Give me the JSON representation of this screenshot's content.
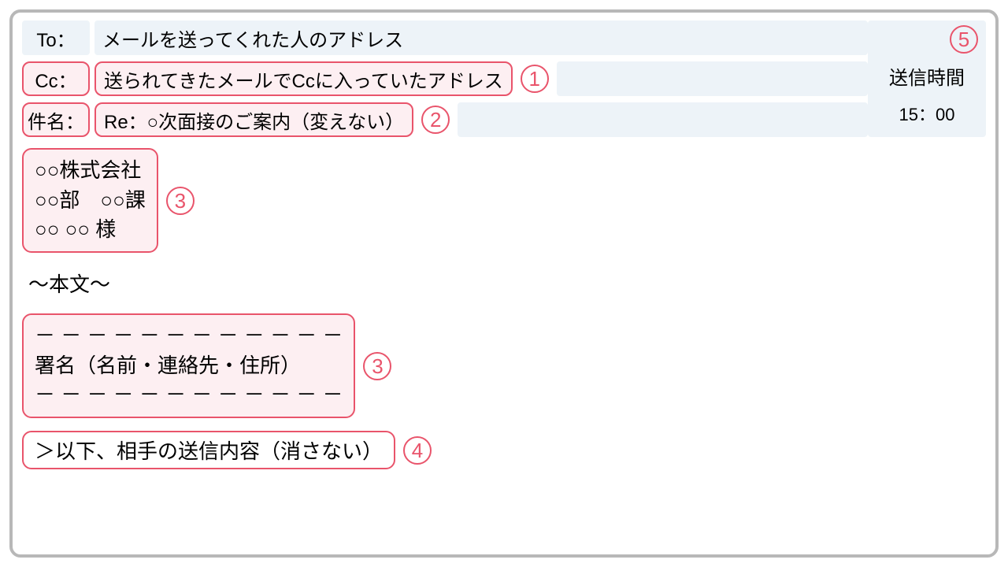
{
  "fields": {
    "to_label": "To：",
    "to_value": "メールを送ってくれた人のアドレス",
    "cc_label": "Cc：",
    "cc_value": "送られてきたメールでCcに入っていたアドレス",
    "subject_label": "件名：",
    "subject_value": "Re：○次面接のご案内（変えない）"
  },
  "time": {
    "label": "送信時間",
    "value": "15：00"
  },
  "body": {
    "addressee_line1": "○○株式会社",
    "addressee_line2": "○○部　○○課",
    "addressee_line3": "○○ ○○ 様",
    "body_marker": "～本文～",
    "sig_dash_top": "－ － － － － － － － － － － －",
    "sig_text": "署名（名前・連絡先・住所）",
    "sig_dash_bottom": "－ － － － － － － － － － － －",
    "quoted": "＞以下、相手の送信内容（消さない）"
  },
  "badges": {
    "n1": "1",
    "n2": "2",
    "n3a": "3",
    "n3b": "3",
    "n4": "4",
    "n5": "5"
  }
}
